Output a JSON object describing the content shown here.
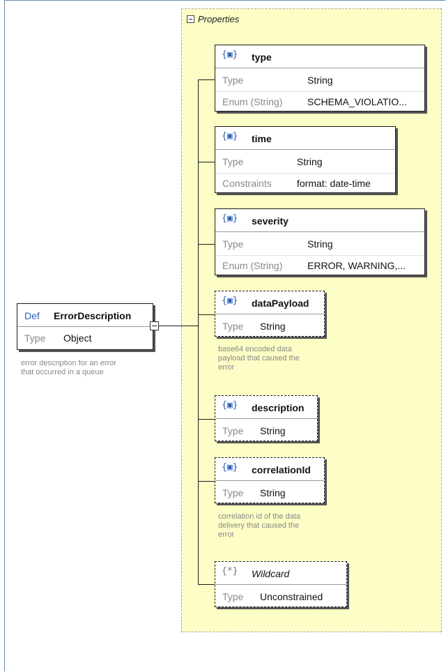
{
  "root": {
    "kind": "Def",
    "name": "ErrorDescription",
    "type_label": "Type",
    "type_value": "Object",
    "note": [
      "error description for an error",
      "that occurred in a queue"
    ]
  },
  "properties": {
    "label": "Properties",
    "items": [
      {
        "icon": "{▣}",
        "name": "type",
        "optional": false,
        "rows": [
          {
            "label": "Type",
            "value": "String"
          },
          {
            "label": "Enum (String)",
            "value": "SCHEMA_VIOLATIO..."
          }
        ],
        "note": []
      },
      {
        "icon": "{▣}",
        "name": "time",
        "optional": false,
        "rows": [
          {
            "label": "Type",
            "value": "String"
          },
          {
            "label": "Constraints",
            "value": "format: date-time"
          }
        ],
        "note": []
      },
      {
        "icon": "{▣}",
        "name": "severity",
        "optional": false,
        "rows": [
          {
            "label": "Type",
            "value": "String"
          },
          {
            "label": "Enum (String)",
            "value": "ERROR, WARNING,..."
          }
        ],
        "note": []
      },
      {
        "icon": "{▣}",
        "name": "dataPayload",
        "optional": true,
        "rows": [
          {
            "label": "Type",
            "value": "String"
          }
        ],
        "note": [
          "base64 encoded data",
          "payload that caused the",
          "error"
        ]
      },
      {
        "icon": "{▣}",
        "name": "description",
        "optional": true,
        "rows": [
          {
            "label": "Type",
            "value": "String"
          }
        ],
        "note": []
      },
      {
        "icon": "{▣}",
        "name": "correlationId",
        "optional": true,
        "rows": [
          {
            "label": "Type",
            "value": "String"
          }
        ],
        "note": [
          "correlation id of the data",
          "delivery that caused the",
          "error"
        ]
      },
      {
        "icon": "{*}",
        "name": "Wildcard",
        "optional": true,
        "italic": true,
        "rows": [
          {
            "label": "Type",
            "value": "Unconstrained"
          }
        ],
        "note": []
      }
    ]
  }
}
